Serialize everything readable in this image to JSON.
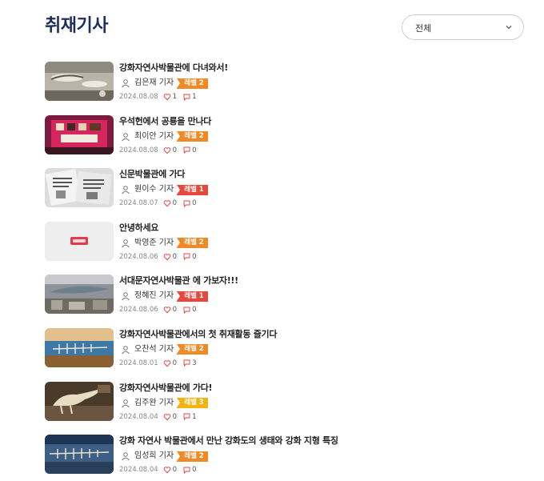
{
  "page": {
    "title": "취재기사"
  },
  "filter": {
    "selected": "전체"
  },
  "colors": {
    "title": "#1f2f5c",
    "level_1": "#e8483b",
    "level_2": "#f08a24",
    "level_3": "#f3b412",
    "heart": "#e0443c",
    "comment": "#e0443c"
  },
  "articles": [
    {
      "title": "강화자연사박물관에 다녀와서!",
      "author": "김은재 기자",
      "level": "레벨 2",
      "level_color": "#f08a24",
      "date": "2024.08.08",
      "likes": "1",
      "comments": "1",
      "thumb": "fossil-ceiling"
    },
    {
      "title": "우석헌에서 공룡을 만나다",
      "author": "최이안 기자",
      "level": "레벨 2",
      "level_color": "#f08a24",
      "date": "2024.08.08",
      "likes": "0",
      "comments": "0",
      "thumb": "pink-display"
    },
    {
      "title": "신문박물관에 가다",
      "author": "원이수 기자",
      "level": "레벨 1",
      "level_color": "#e8483b",
      "date": "2024.08.07",
      "likes": "0",
      "comments": "0",
      "thumb": "newspapers"
    },
    {
      "title": "안녕하세요",
      "author": "박영준 기자",
      "level": "레벨 2",
      "level_color": "#f08a24",
      "date": "2024.08.06",
      "likes": "0",
      "comments": "0",
      "thumb": "logo-placeholder"
    },
    {
      "title": "서대문자연사박물관 에 가보자!!!",
      "author": "정혜진 기자",
      "level": "레벨 1",
      "level_color": "#e8483b",
      "date": "2024.08.06",
      "likes": "0",
      "comments": "0",
      "thumb": "whale-hall"
    },
    {
      "title": "강화자연사박물관에서의 첫 취재활동 즐기다",
      "author": "오찬석 기자",
      "level": "레벨 2",
      "level_color": "#f08a24",
      "date": "2024.08.01",
      "likes": "0",
      "comments": "3",
      "thumb": "whale-skeleton"
    },
    {
      "title": "강화자연사박물관에 가다!",
      "author": "김주완 기자",
      "level": "레벨 3",
      "level_color": "#f3b412",
      "date": "2024.08.04",
      "likes": "0",
      "comments": "1",
      "thumb": "dinosaur"
    },
    {
      "title": "강화 자연사 박물관에서 만난 강화도의 생태와 강화 지형 특징",
      "author": "임성희 기자",
      "level": "레벨 2",
      "level_color": "#f08a24",
      "date": "2024.08.04",
      "likes": "0",
      "comments": "0",
      "thumb": "whale-blue"
    }
  ]
}
